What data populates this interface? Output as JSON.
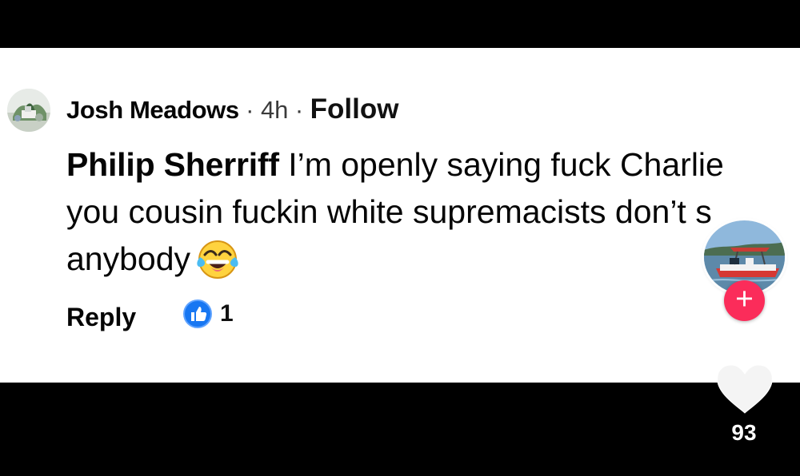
{
  "comment": {
    "author": "Josh Meadows",
    "separator_1": "·",
    "age": "4h",
    "separator_2": "·",
    "follow_label": "Follow",
    "mention": "Philip Sherriff",
    "lines": [
      " I’m openly saying fuck Charlie",
      "you cousin fuckin white supremacists don’t s",
      "anybody"
    ],
    "emoji": "face-with-tears-of-joy-icon",
    "reply_label": "Reply",
    "reaction_icon": "thumbs-up-icon",
    "reaction_count": "1"
  },
  "side_rail": {
    "creator_avatar": "boat-avatar",
    "follow_icon": "plus-icon",
    "follow_symbol": "+",
    "like_icon": "heart-icon",
    "like_count": "93"
  },
  "colors": {
    "background": "#000000",
    "card": "#ffffff",
    "text": "#050505",
    "muted": "#3b3b3b",
    "reaction_blue": "#1877f2",
    "follow_red": "#fb2c5a",
    "heart": "#ffffff"
  }
}
